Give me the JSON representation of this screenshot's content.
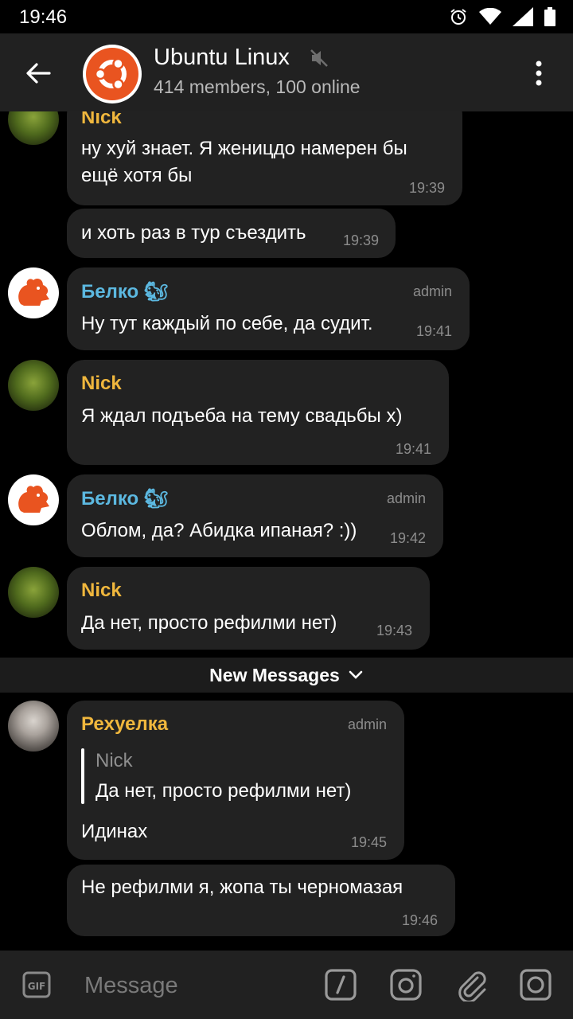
{
  "status_bar": {
    "time": "19:46"
  },
  "header": {
    "title": "Ubuntu Linux",
    "subtitle": "414 members, 100 online",
    "muted": true
  },
  "messages": [
    {
      "sender": "Nick",
      "text": "ну хуй знает. Я женицдо намерен бы\nещё хотя бы",
      "time": "19:39"
    },
    {
      "text": "и хоть раз в тур съездить",
      "time": "19:39"
    },
    {
      "sender": "Белко 🐿",
      "badge": "admin",
      "text": "Ну тут каждый по себе, да судит.",
      "time": "19:41"
    },
    {
      "sender": "Nick",
      "text": "Я ждал подъеба на тему свадьбы х)",
      "time": "19:41"
    },
    {
      "sender": "Белко 🐿",
      "badge": "admin",
      "text": "Облом, да? Абидка ипаная? :))",
      "time": "19:42"
    },
    {
      "sender": "Nick",
      "text": "Да нет, просто рефилми нет)",
      "time": "19:43"
    },
    {
      "sender": "Рехуелка",
      "badge": "admin",
      "reply": {
        "name": "Nick",
        "text": "Да нет, просто рефилми нет)"
      },
      "text": "Идинах",
      "time": "19:45"
    },
    {
      "text": "Не рефилми я, жопа ты  черномазая",
      "time": "19:46"
    }
  ],
  "new_messages_label": "New Messages",
  "composer": {
    "placeholder": "Message"
  },
  "colors": {
    "sender_gold": "#f0b73d",
    "sender_blue": "#5cb8e0",
    "bubble": "#222222",
    "ubuntu_orange": "#e95420"
  }
}
